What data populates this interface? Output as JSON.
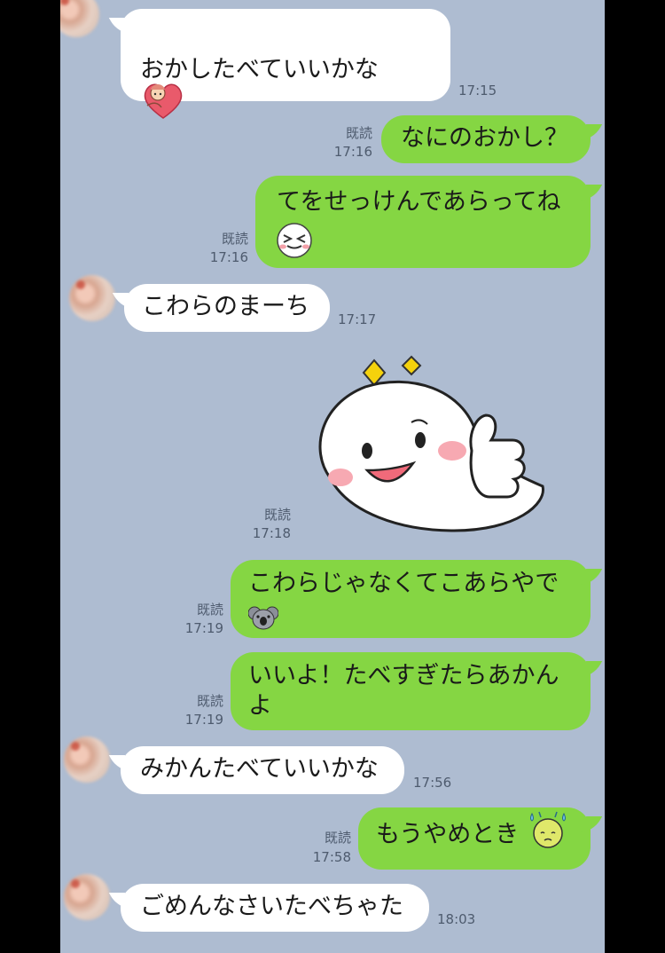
{
  "colors": {
    "background": "#aebcd1",
    "incoming": "#ffffff",
    "outgoing": "#85d643",
    "meta_text": "#4e5b6e"
  },
  "messages": [
    {
      "dir": "in",
      "text": "おかしたべていいかな",
      "emoji": "heart-hug-emoji",
      "time": "17:15"
    },
    {
      "dir": "out",
      "text": "なにのおかし？",
      "read": "既読",
      "time": "17:16"
    },
    {
      "dir": "out",
      "text": "てをせっけんであらってね",
      "emoji": "squint-face-emoji",
      "read": "既読",
      "time": "17:16"
    },
    {
      "dir": "in",
      "text": "こわらのまーち",
      "time": "17:17"
    },
    {
      "dir": "out",
      "sticker": "thumbs-up-blob-sticker",
      "read": "既読",
      "time": "17:18"
    },
    {
      "dir": "out",
      "text": "こわらじゃなくてこあらやで",
      "emoji": "koala-emoji",
      "read": "既読",
      "time": "17:19"
    },
    {
      "dir": "out",
      "text_line1": "いいよ！たべすぎたらあかん",
      "text_line2": "よ",
      "read": "既読",
      "time": "17:19"
    },
    {
      "dir": "in",
      "text": "みかんたべていいかな",
      "time": "17:56"
    },
    {
      "dir": "out",
      "text": "もうやめとき",
      "emoji": "sweat-face-emoji",
      "read": "既読",
      "time": "17:58"
    },
    {
      "dir": "in",
      "text": "ごめんなさいたべちゃた",
      "time": "18:03"
    }
  ]
}
